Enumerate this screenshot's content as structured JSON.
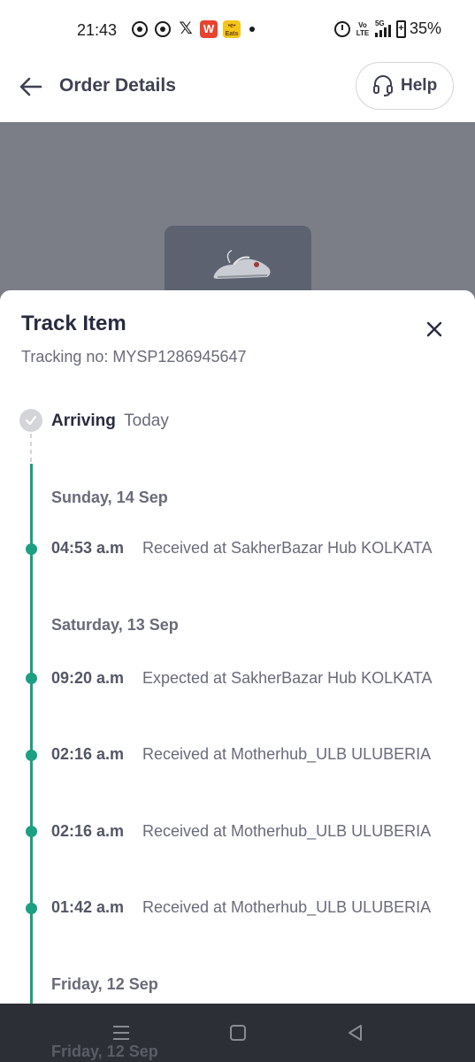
{
  "status_bar": {
    "time": "21:43",
    "notification_icons": [
      "whatsapp-icon",
      "whatsapp-icon",
      "x-icon",
      "wps-office-icon",
      "eats-icon",
      "dot-icon"
    ],
    "volte": "Vo LTE",
    "network": "5G",
    "battery_percent": "35%"
  },
  "header": {
    "title": "Order Details",
    "help_label": "Help"
  },
  "sheet": {
    "title": "Track Item",
    "tracking_label": "Tracking no:",
    "tracking_number": "MYSP1286945647",
    "arriving_label": "Arriving",
    "arriving_value": "Today",
    "dates": [
      {
        "date": "Sunday, 14 Sep",
        "events": [
          {
            "time": "04:53 a.m",
            "text": "Received at SakherBazar Hub KOLKATA"
          }
        ]
      },
      {
        "date": "Saturday, 13 Sep",
        "events": [
          {
            "time": "09:20 a.m",
            "text": "Expected at SakherBazar Hub KOLKATA"
          },
          {
            "time": "02:16 a.m",
            "text": "Received at Motherhub_ULB ULUBERIA"
          },
          {
            "time": "02:16 a.m",
            "text": "Received at Motherhub_ULB ULUBERIA"
          },
          {
            "time": "01:42 a.m",
            "text": "Received at Motherhub_ULB ULUBERIA"
          }
        ]
      },
      {
        "date": "Friday, 12 Sep",
        "events": []
      }
    ]
  },
  "colors": {
    "accent_green": "#1ba081",
    "text_dark": "#282c3f",
    "text_muted": "#696b79",
    "nav_bar": "#2d2f36"
  }
}
